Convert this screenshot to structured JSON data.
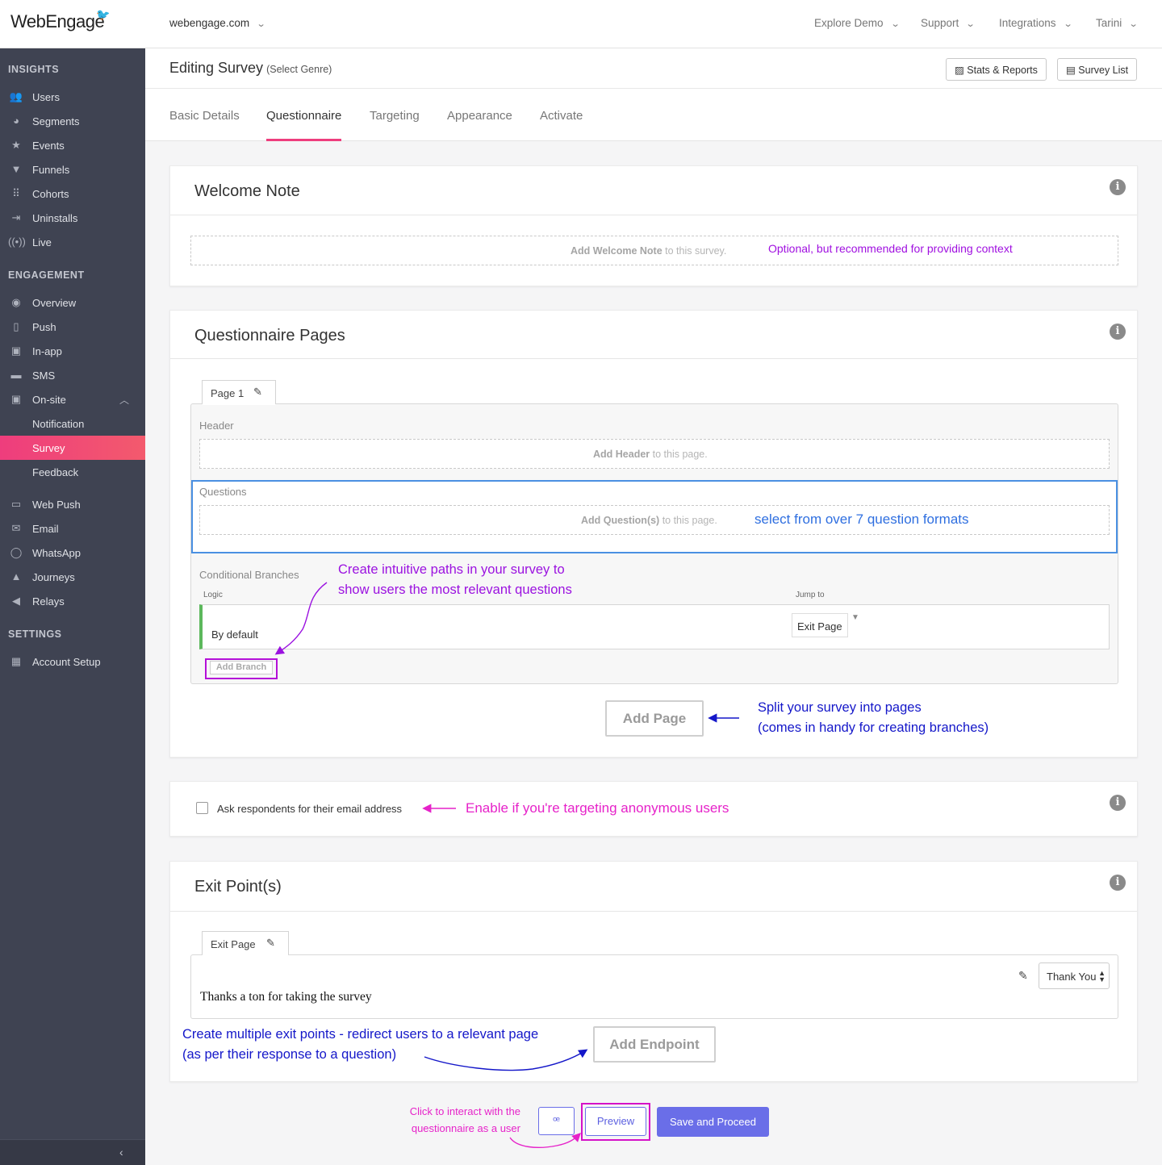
{
  "brand": {
    "logo_text": "WebEngage",
    "accent": "#ee3d7d",
    "sidebar_bg": "#3f4352"
  },
  "topbar": {
    "domain": "webengage.com",
    "nav": [
      "Explore Demo",
      "Support",
      "Integrations",
      "Tarini"
    ]
  },
  "sidebar": {
    "insights_title": "INSIGHTS",
    "insights": [
      {
        "label": "Users",
        "icon": "users-icon"
      },
      {
        "label": "Segments",
        "icon": "pie-chart-icon"
      },
      {
        "label": "Events",
        "icon": "star-icon"
      },
      {
        "label": "Funnels",
        "icon": "filter-icon"
      },
      {
        "label": "Cohorts",
        "icon": "grid-icon"
      },
      {
        "label": "Uninstalls",
        "icon": "uninstall-icon"
      },
      {
        "label": "Live",
        "icon": "broadcast-icon"
      }
    ],
    "engagement_title": "ENGAGEMENT",
    "engagement": [
      {
        "label": "Overview",
        "icon": "eye-icon"
      },
      {
        "label": "Push",
        "icon": "mobile-push-icon"
      },
      {
        "label": "In-app",
        "icon": "in-app-icon"
      },
      {
        "label": "SMS",
        "icon": "sms-icon"
      },
      {
        "label": "On-site",
        "icon": "on-site-icon"
      },
      {
        "label": "Notification",
        "icon": ""
      },
      {
        "label": "Survey",
        "icon": ""
      },
      {
        "label": "Feedback",
        "icon": ""
      },
      {
        "label": "Web Push",
        "icon": "web-push-icon"
      },
      {
        "label": "Email",
        "icon": "email-icon"
      },
      {
        "label": "WhatsApp",
        "icon": "whatsapp-icon"
      },
      {
        "label": "Journeys",
        "icon": "rocket-icon"
      },
      {
        "label": "Relays",
        "icon": "megaphone-icon"
      }
    ],
    "settings_title": "SETTINGS",
    "settings": [
      {
        "label": "Account Setup",
        "icon": "dashboard-icon"
      }
    ],
    "active_item": "Survey"
  },
  "header": {
    "title": "Editing Survey",
    "genre": "(Select Genre)",
    "stats_button": "Stats & Reports",
    "survey_list_button": "Survey List"
  },
  "tabs": [
    {
      "label": "Basic Details",
      "active": false
    },
    {
      "label": "Questionnaire",
      "active": true
    },
    {
      "label": "Targeting",
      "active": false
    },
    {
      "label": "Appearance",
      "active": false
    },
    {
      "label": "Activate",
      "active": false
    }
  ],
  "welcome": {
    "title": "Welcome Note",
    "add_bold": "Add Welcome Note",
    "add_rest": " to this survey.",
    "annotation": "Optional, but recommended for providing context"
  },
  "questionnaire": {
    "title": "Questionnaire Pages",
    "page_tab": "Page 1",
    "header_label": "Header",
    "header_add_bold": "Add Header",
    "header_add_rest": " to this page.",
    "questions_label": "Questions",
    "questions_add_bold": "Add Question(s)",
    "questions_add_rest": " to this page.",
    "questions_annotation": "select from over 7 question formats",
    "branches_label": "Conditional Branches",
    "logic_label": "Logic",
    "jump_label": "Jump to",
    "default_label": "By default",
    "jump_value": "Exit Page",
    "add_branch": "Add Branch",
    "branch_annotation_1": "Create intuitive paths in your survey to",
    "branch_annotation_2": "show users the most relevant questions",
    "add_page": "Add Page",
    "page_annotation_1": "Split your survey into pages",
    "page_annotation_2": "(comes in handy for creating branches)"
  },
  "email_option": {
    "label": "Ask respondents for their email address",
    "checked": false,
    "annotation": "Enable if you're targeting anonymous users"
  },
  "exit": {
    "title": "Exit Point(s)",
    "tab": "Exit Page",
    "message": "Thanks a ton for taking the survey",
    "select_value": "Thank You",
    "add_endpoint": "Add Endpoint",
    "annotation_1": "Create multiple exit points - redirect users to a relevant page",
    "annotation_2": "(as per their response to a question)"
  },
  "footer": {
    "annotation_1": "Click to interact with the",
    "annotation_2": "questionnaire as a user",
    "preview": "Preview",
    "save": "Save and Proceed"
  }
}
